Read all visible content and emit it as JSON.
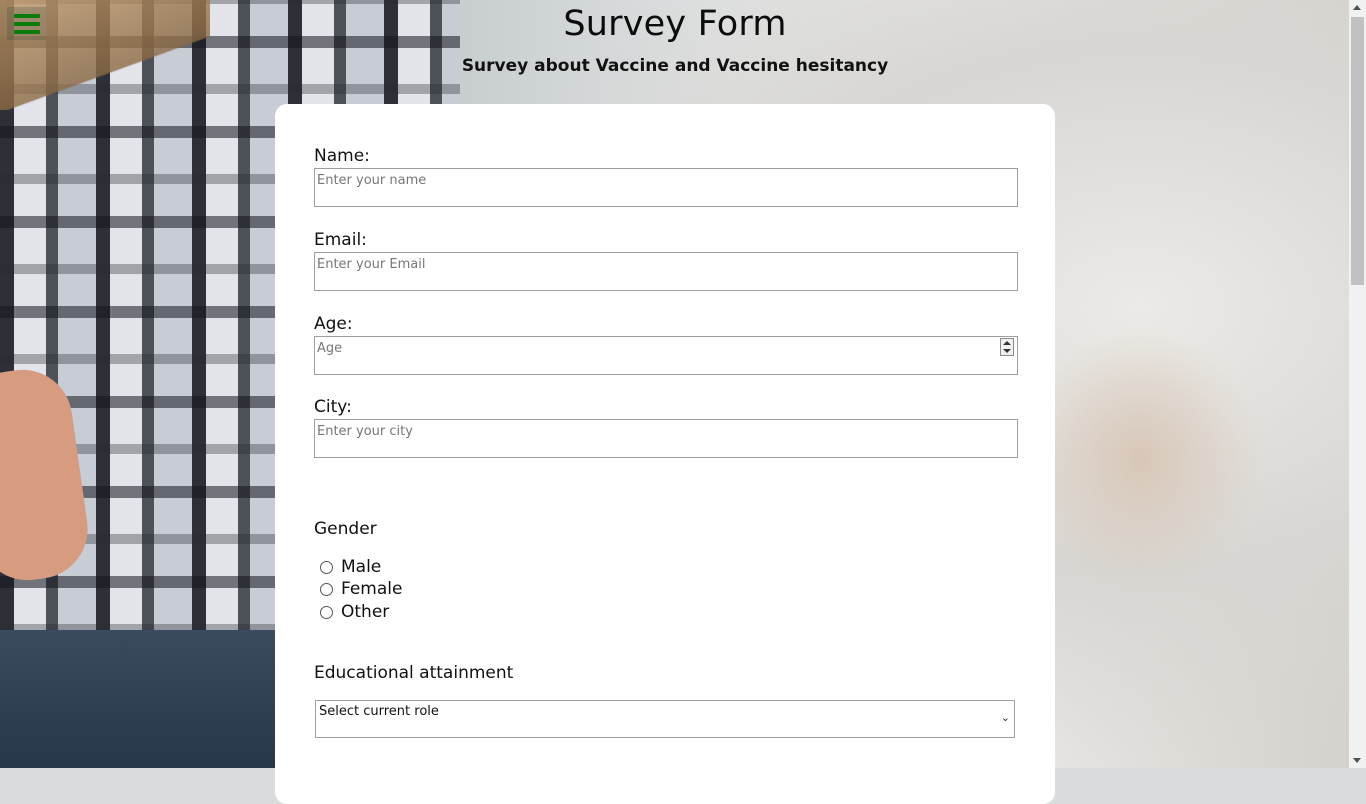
{
  "header": {
    "title": "Survey Form",
    "subtitle": "Survey about Vaccine and Vaccine hesitancy"
  },
  "menu": {
    "icon": "hamburger-menu-icon"
  },
  "form": {
    "name": {
      "label": "Name:",
      "placeholder": "Enter your name"
    },
    "email": {
      "label": "Email:",
      "placeholder": "Enter your Email"
    },
    "age": {
      "label": "Age:",
      "placeholder": "Age"
    },
    "city": {
      "label": "City:",
      "placeholder": "Enter your city"
    },
    "gender": {
      "title": "Gender",
      "options": [
        "Male",
        "Female",
        "Other"
      ]
    },
    "education": {
      "title": "Educational attainment",
      "selected": "Select current role"
    }
  },
  "colors": {
    "menu_icon": "#0a7a0a",
    "card": "#ffffff"
  }
}
